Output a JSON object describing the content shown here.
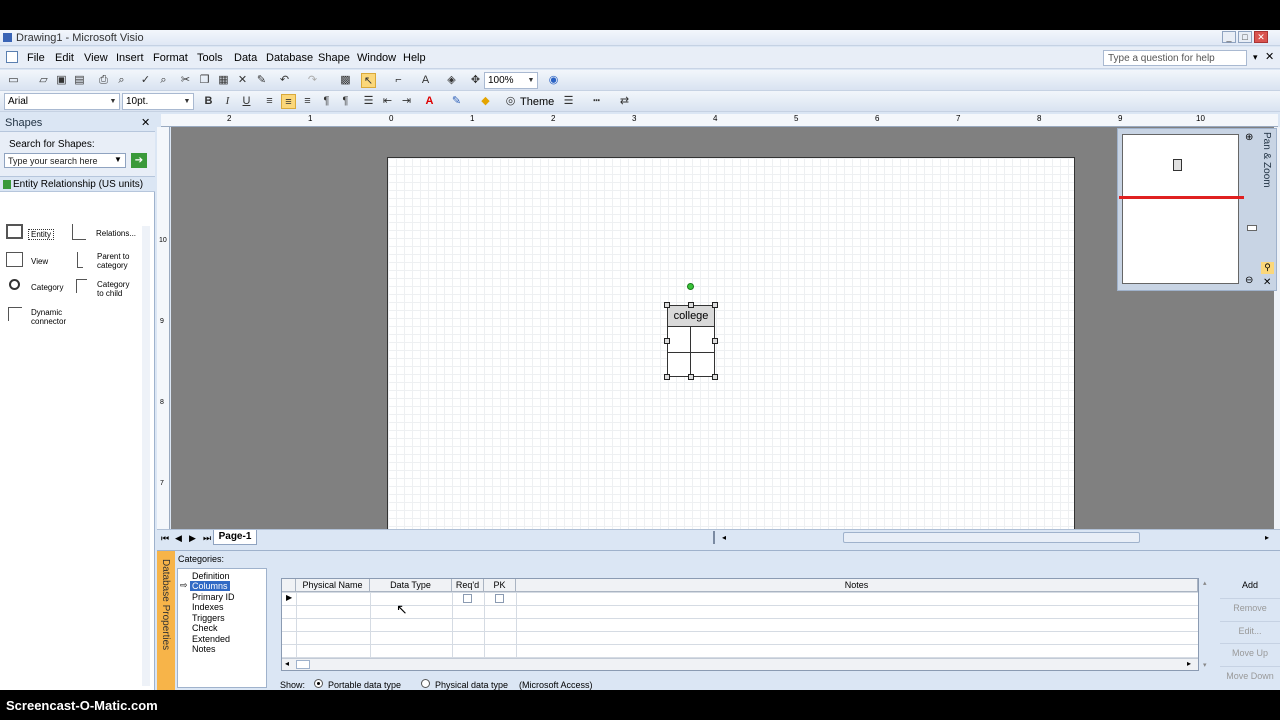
{
  "window": {
    "title": "Drawing1 - Microsoft Visio"
  },
  "menu": [
    "File",
    "Edit",
    "View",
    "Insert",
    "Format",
    "Tools",
    "Data",
    "Database",
    "Shape",
    "Window",
    "Help"
  ],
  "help_box": {
    "placeholder": "Type a question for help"
  },
  "toolbar": {
    "zoom": "100%",
    "font": "Arial",
    "size": "10pt.",
    "theme_label": "Theme"
  },
  "shapes_panel": {
    "title": "Shapes",
    "search_label": "Search for Shapes:",
    "search_placeholder": "Type your search here",
    "stencil_name": "Entity Relationship (US units)",
    "items": [
      {
        "label": "Entity",
        "icon": "entity-icon"
      },
      {
        "label": "Relations...",
        "icon": "relationship-icon"
      },
      {
        "label": "View",
        "icon": "view-icon"
      },
      {
        "label": "Parent to category",
        "icon": "parent-category-icon"
      },
      {
        "label": "Category",
        "icon": "category-icon"
      },
      {
        "label": "Category to child",
        "icon": "category-child-icon"
      },
      {
        "label": "Dynamic connector",
        "icon": "connector-icon"
      }
    ]
  },
  "ruler": {
    "top_ticks": [
      "2",
      "1",
      "0",
      "1",
      "2",
      "3",
      "4",
      "5",
      "6",
      "7",
      "8",
      "9",
      "10"
    ],
    "left_ticks": [
      "10",
      "9",
      "8",
      "7"
    ]
  },
  "entity": {
    "name": "college"
  },
  "page_tabs": {
    "current": "Page-1"
  },
  "pan_zoom": {
    "title": "Pan & Zoom"
  },
  "db_properties": {
    "panel_title": "Database Properties",
    "categories_label": "Categories:",
    "categories": [
      "Definition",
      "Columns",
      "Primary ID",
      "Indexes",
      "Triggers",
      "Check",
      "Extended",
      "Notes"
    ],
    "selected_category": "Columns",
    "columns": [
      "Physical Name",
      "Data Type",
      "Req'd",
      "PK",
      "Notes"
    ],
    "buttons": [
      "Add",
      "Remove",
      "Edit...",
      "Move Up",
      "Move Down"
    ],
    "show_label": "Show:",
    "show_options": [
      "Portable data type",
      "Physical data type"
    ],
    "show_selected": "Portable data type",
    "target": "(Microsoft Access)"
  },
  "watermark": "Screencast-O-Matic.com"
}
